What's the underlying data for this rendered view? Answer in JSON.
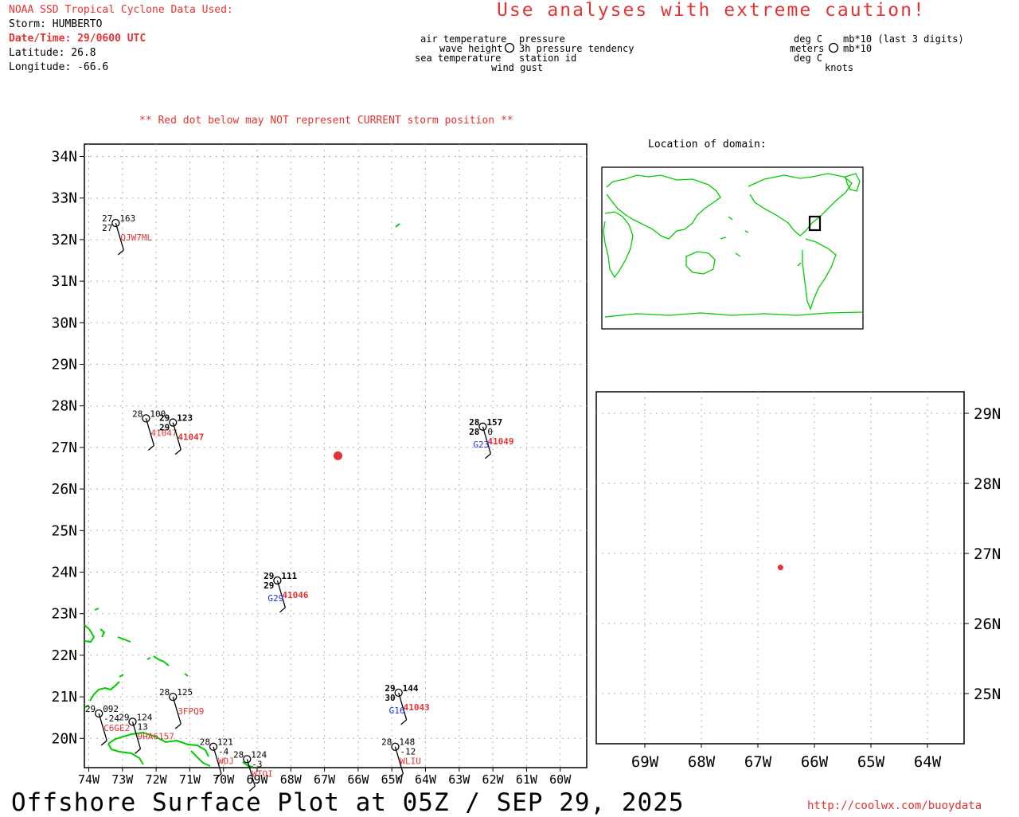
{
  "header": {
    "source": "NOAA SSD Tropical Cyclone Data Used:",
    "storm": "Storm: HUMBERTO",
    "datetime": "Date/Time: 29/0600 UTC",
    "latitude": "Latitude: 26.8",
    "longitude": "Longitude: -66.6",
    "caution": "Use analyses with extreme caution!"
  },
  "legend": {
    "air_temperature": "air temperature",
    "wave_height": "wave height",
    "sea_temperature": "sea temperature",
    "pressure": "pressure",
    "pressure_tendency": "3h pressure tendency",
    "station_id": "station id",
    "wind_gust": "wind gust",
    "deg_c_1": "deg C",
    "meters": "meters",
    "deg_c_2": "deg C",
    "mb10_last3": "mb*10 (last 3 digits)",
    "mb10": "mb*10",
    "knots": "knots"
  },
  "notice": "** Red dot below may NOT represent CURRENT storm position **",
  "inset_title": "Location of domain:",
  "footer": {
    "title": "Offshore Surface Plot at 05Z / SEP 29, 2025",
    "url": "http://coolwx.com/buoydata"
  },
  "main_map": {
    "lat_labels": [
      "34N",
      "33N",
      "32N",
      "31N",
      "30N",
      "29N",
      "28N",
      "27N",
      "26N",
      "25N",
      "24N",
      "23N",
      "22N",
      "21N",
      "20N"
    ],
    "lon_labels": [
      "74W",
      "73W",
      "72W",
      "71W",
      "70W",
      "69W",
      "68W",
      "67W",
      "66W",
      "65W",
      "64W",
      "63W",
      "62W",
      "61W",
      "60W"
    ],
    "storm_position": {
      "lat": 26.8,
      "lon": -66.6
    },
    "stations": [
      {
        "name": "QJW7ML",
        "lat": 32.4,
        "lon": -73.2,
        "air": "27",
        "sea": "27",
        "pressure": "163",
        "gust": "",
        "tendency": ""
      },
      {
        "name": "41047 (left)",
        "lat": 27.7,
        "lon": -72.3,
        "air": "28",
        "sea": "",
        "pressure": "100",
        "gust": "",
        "tendency": ""
      },
      {
        "name": "41047",
        "lat": 27.6,
        "lon": -71.5,
        "air": "29",
        "sea": "29",
        "pressure": "123",
        "gust": "",
        "tendency": ""
      },
      {
        "name": "41049",
        "lat": 27.5,
        "lon": -62.3,
        "air": "28",
        "sea": "28",
        "pressure": "157",
        "gust": "G23",
        "tendency": "0"
      },
      {
        "name": "41046",
        "lat": 23.8,
        "lon": -68.4,
        "air": "29",
        "sea": "29",
        "pressure": "111",
        "gust": "G29",
        "tendency": ""
      },
      {
        "name": "3FPQ9",
        "lat": 21.0,
        "lon": -71.5,
        "air": "28",
        "sea": "",
        "pressure": "125",
        "gust": "",
        "tendency": ""
      },
      {
        "name": "C6GE2",
        "lat": 20.6,
        "lon": -73.7,
        "air": "29",
        "sea": "",
        "pressure": "092",
        "gust": "",
        "tendency": "-24"
      },
      {
        "name": "9HA6157",
        "lat": 20.4,
        "lon": -72.7,
        "air": "29",
        "sea": "",
        "pressure": "124",
        "gust": "",
        "tendency": "13"
      },
      {
        "name": "41043",
        "lat": 21.1,
        "lon": -64.8,
        "air": "29",
        "sea": "30",
        "pressure": "144",
        "gust": "G16",
        "tendency": ""
      },
      {
        "name": "WDJ",
        "lat": 19.8,
        "lon": -70.3,
        "air": "28",
        "sea": "",
        "pressure": "121",
        "gust": "",
        "tendency": "-4"
      },
      {
        "name": "WTOI",
        "lat": 19.5,
        "lon": -69.3,
        "air": "28",
        "sea": "",
        "pressure": "124",
        "gust": "",
        "tendency": "-3"
      },
      {
        "name": "WLIU",
        "lat": 19.8,
        "lon": -64.9,
        "air": "28",
        "sea": "",
        "pressure": "148",
        "gust": "",
        "tendency": "-12"
      }
    ]
  },
  "zoom_map": {
    "lat_labels": [
      "29N",
      "28N",
      "27N",
      "26N",
      "25N"
    ],
    "lon_labels": [
      "69W",
      "68W",
      "67W",
      "66W",
      "65W",
      "64W"
    ]
  },
  "colors": {
    "accent_red": "#e53333",
    "coast_green": "#00cc00",
    "gust_blue": "#1a33e6",
    "grid": "#999999"
  }
}
